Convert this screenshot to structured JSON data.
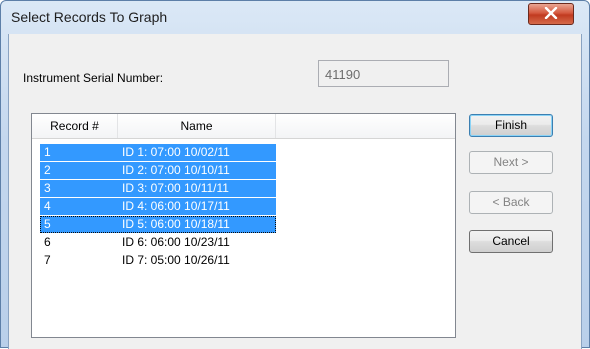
{
  "window": {
    "title": "Select Records To Graph",
    "close_icon": "close-icon"
  },
  "serial": {
    "label": "Instrument Serial Number:",
    "value": "41190"
  },
  "list": {
    "columns": [
      "Record #",
      "Name",
      ""
    ],
    "rows": [
      {
        "record": "1",
        "name": "ID 1: 07:00 10/02/11",
        "selected": true
      },
      {
        "record": "2",
        "name": "ID 2: 07:00 10/10/11",
        "selected": true
      },
      {
        "record": "3",
        "name": "ID 3: 07:00 10/11/11",
        "selected": true
      },
      {
        "record": "4",
        "name": "ID 4: 06:00 10/17/11",
        "selected": true
      },
      {
        "record": "5",
        "name": "ID 5: 06:00 10/18/11",
        "selected": true,
        "focused": true
      },
      {
        "record": "6",
        "name": "ID 6: 06:00 10/23/11",
        "selected": false
      },
      {
        "record": "7",
        "name": "ID 7: 05:00 10/26/11",
        "selected": false
      }
    ]
  },
  "buttons": {
    "finish": "Finish",
    "next": "Next >",
    "back": "< Back",
    "cancel": "Cancel"
  },
  "colors": {
    "selection": "#3399ff",
    "close_button": "#c94b2f"
  }
}
